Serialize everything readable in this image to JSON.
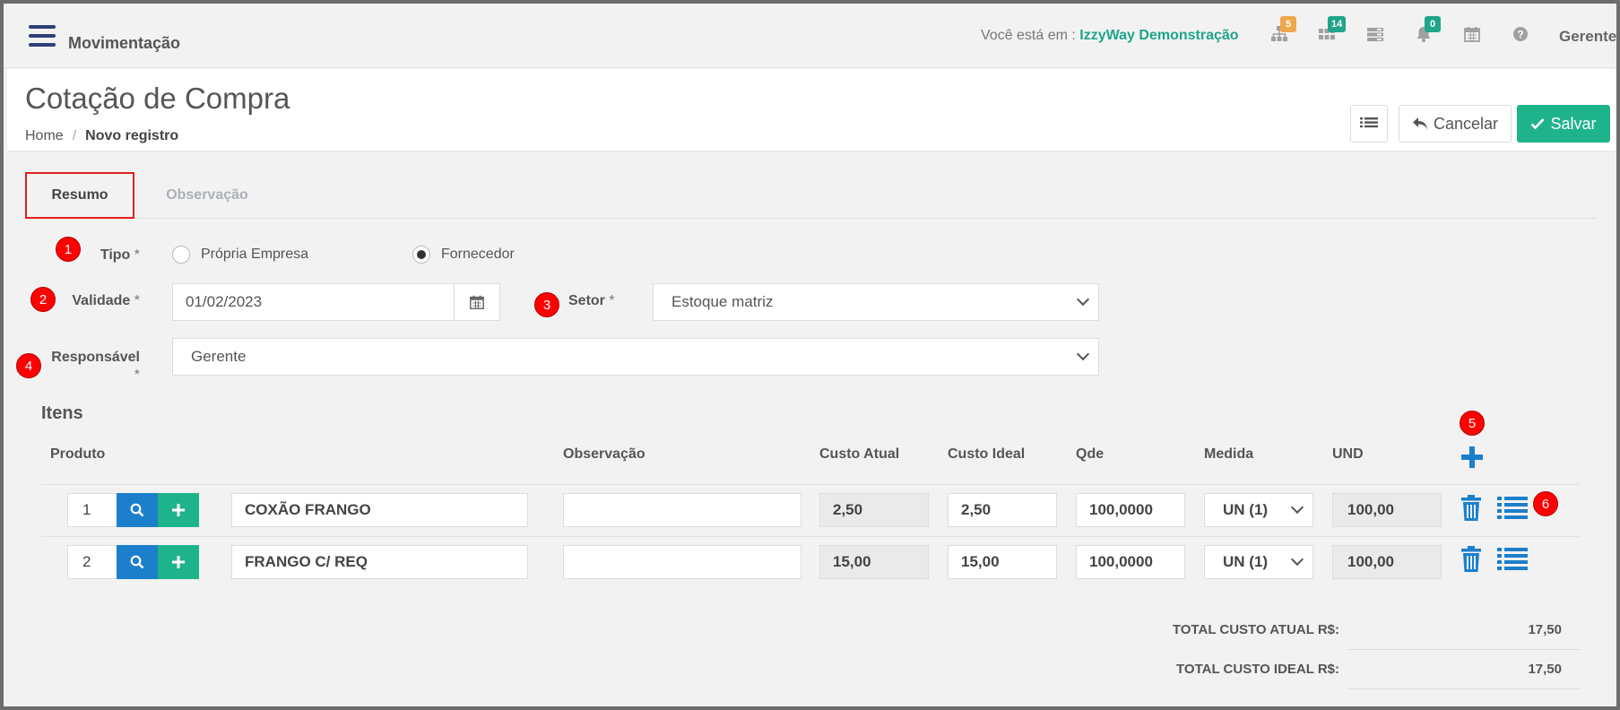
{
  "topbar": {
    "app_title": "Movimentação",
    "location_prefix": "Você está em :",
    "location_name": "IzzyWay Demonstração",
    "badges": {
      "sitemap": "5",
      "grid": "14",
      "bell": "0"
    },
    "user": "Gerente"
  },
  "header": {
    "title": "Cotação de Compra",
    "breadcrumb_home": "Home",
    "breadcrumb_sep": "/",
    "breadcrumb_current": "Novo registro",
    "cancel_label": "Cancelar",
    "save_label": "Salvar"
  },
  "tabs": {
    "resumo": "Resumo",
    "observacao": "Observação"
  },
  "markers": [
    "1",
    "2",
    "3",
    "4",
    "5",
    "6"
  ],
  "form": {
    "tipo_label": "Tipo",
    "required": "*",
    "radio_propria": "Própria Empresa",
    "radio_fornecedor": "Fornecedor",
    "validade_label": "Validade",
    "validade_value": "01/02/2023",
    "setor_label": "Setor",
    "setor_value": "Estoque matriz",
    "responsavel_label": "Responsável",
    "responsavel_value": "Gerente"
  },
  "items": {
    "title": "Itens",
    "headers": {
      "produto": "Produto",
      "observacao": "Observação",
      "custo_atual": "Custo Atual",
      "custo_ideal": "Custo Ideal",
      "qde": "Qde",
      "medida": "Medida",
      "und": "UND"
    },
    "rows": [
      {
        "num": "1",
        "produto": "COXÃO FRANGO",
        "observacao": "",
        "custo_atual": "2,50",
        "custo_ideal": "2,50",
        "qde": "100,0000",
        "medida": "UN (1)",
        "und": "100,00"
      },
      {
        "num": "2",
        "produto": "FRANGO C/ REQ",
        "observacao": "",
        "custo_atual": "15,00",
        "custo_ideal": "15,00",
        "qde": "100,0000",
        "medida": "UN (1)",
        "und": "100,00"
      }
    ]
  },
  "totals": {
    "atual_label": "TOTAL CUSTO ATUAL R$:",
    "atual_value": "17,50",
    "ideal_label": "TOTAL CUSTO IDEAL R$:",
    "ideal_value": "17,50"
  },
  "colors": {
    "accent": "#1fa58a",
    "primary": "#1c7fcb",
    "marker": "#ff0000"
  }
}
